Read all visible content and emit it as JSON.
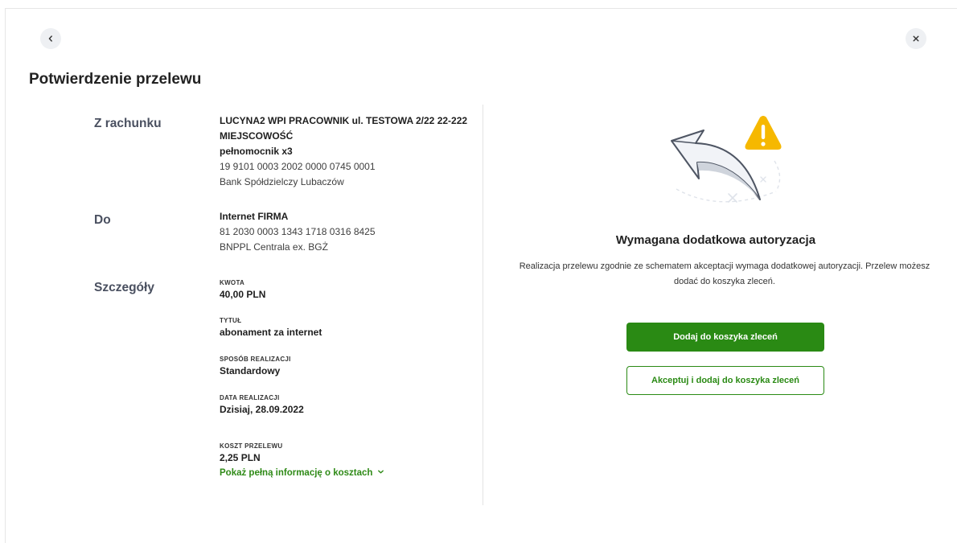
{
  "page": {
    "title": "Potwierdzenie przelewu"
  },
  "icons": {
    "back": "chevron-left-icon",
    "close": "close-icon",
    "warning": "warning-icon"
  },
  "from": {
    "label": "Z rachunku",
    "owner_line1": "LUCYNA2 WPI PRACOWNIK ul. TESTOWA 2/22 22-222",
    "owner_line2": "MIEJSCOWOŚĆ",
    "role": "pełnomocnik x3",
    "account": "19 9101 0003 2002 0000 0745 0001",
    "bank": "Bank Spółdzielczy Lubaczów"
  },
  "to": {
    "label": "Do",
    "name": "Internet FIRMA",
    "account": "81 2030 0003 1343 1718 0316 8425",
    "bank": "BNPPL Centrala ex. BGŻ"
  },
  "details": {
    "label": "Szczegóły",
    "amount_caption": "KWOTA",
    "amount": "40,00 PLN",
    "title_caption": "TYTUŁ",
    "title": "abonament za internet",
    "method_caption": "SPOSÓB REALIZACJI",
    "method": "Standardowy",
    "date_caption": "DATA REALIZACJI",
    "date": "Dzisiaj, 28.09.2022",
    "cost_caption": "KOSZT PRZELEWU",
    "cost": "2,25 PLN",
    "cost_link": "Pokaż pełną informację o kosztach"
  },
  "authorization": {
    "title": "Wymagana dodatkowa autoryzacja",
    "description": "Realizacja przelewu zgodnie ze schematem akceptacji wymaga dodatkowej autoryzacji. Przelew możesz dodać do koszyka zleceń.",
    "primary_button": "Dodaj do koszyka zleceń",
    "secondary_button": "Akceptuj i dodaj do koszyka zleceń"
  },
  "colors": {
    "accent": "#2a8a14",
    "warning": "#f6b800",
    "label": "#4a5060"
  }
}
